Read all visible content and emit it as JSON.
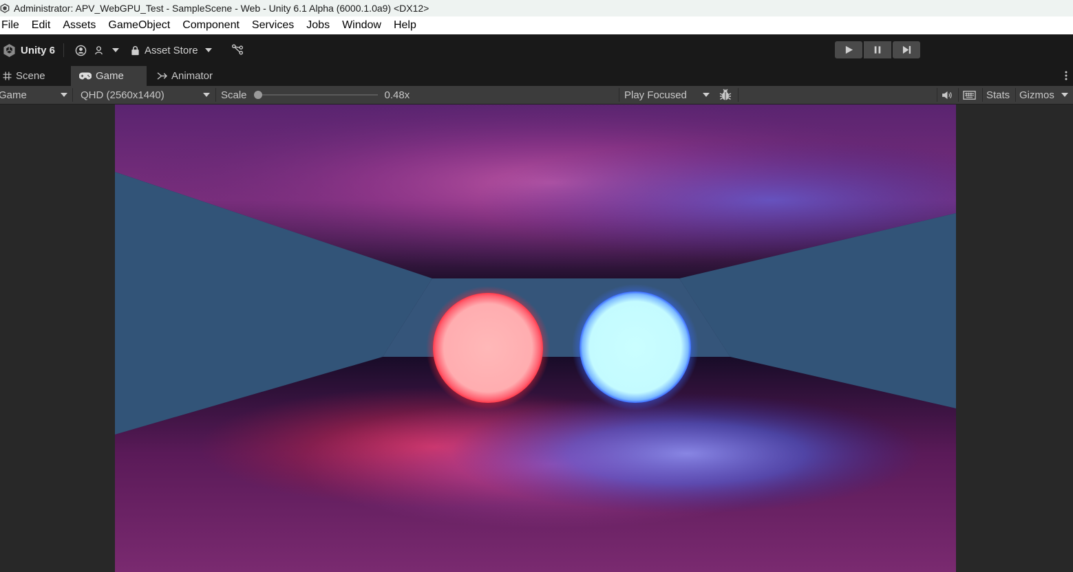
{
  "window": {
    "title": "Administrator: APV_WebGPU_Test - SampleScene - Web - Unity 6.1 Alpha (6000.1.0a9) <DX12>"
  },
  "menu": [
    "File",
    "Edit",
    "Assets",
    "GameObject",
    "Component",
    "Services",
    "Jobs",
    "Window",
    "Help"
  ],
  "toolbar": {
    "brand": "Unity 6",
    "asset_store": "Asset Store",
    "icons": [
      "unity-logo-icon",
      "account-icon",
      "collab-icon",
      "lock-icon",
      "version-control-icon",
      "play-icon",
      "pause-icon",
      "step-icon"
    ]
  },
  "tabs": [
    {
      "label": "Scene",
      "icon": "grid-icon",
      "active": false
    },
    {
      "label": "Game",
      "icon": "gamepad-icon",
      "active": true
    },
    {
      "label": "Animator",
      "icon": "animator-icon",
      "active": false
    }
  ],
  "game_toolbar": {
    "display": "Game",
    "resolution": "QHD (2560x1440)",
    "scale_label": "Scale",
    "scale_value": "0.48x",
    "scale_level": 0.0,
    "play_mode": "Play Focused",
    "stats": "Stats",
    "gizmos": "Gizmos"
  },
  "scene": {
    "spheres": [
      {
        "name": "red-glowing-sphere",
        "color": "#ffb4b4",
        "glow": "#ff3a4a"
      },
      {
        "name": "cyan-glowing-sphere",
        "color": "#c8ffff",
        "glow": "#3a7aff"
      }
    ],
    "colors": {
      "wall": "#325478",
      "ceiling_purple": "#6a2a70",
      "floor_purple": "#5a1f5a",
      "accent_pink": "#d04aa0",
      "accent_blue": "#5a6ae0"
    }
  }
}
